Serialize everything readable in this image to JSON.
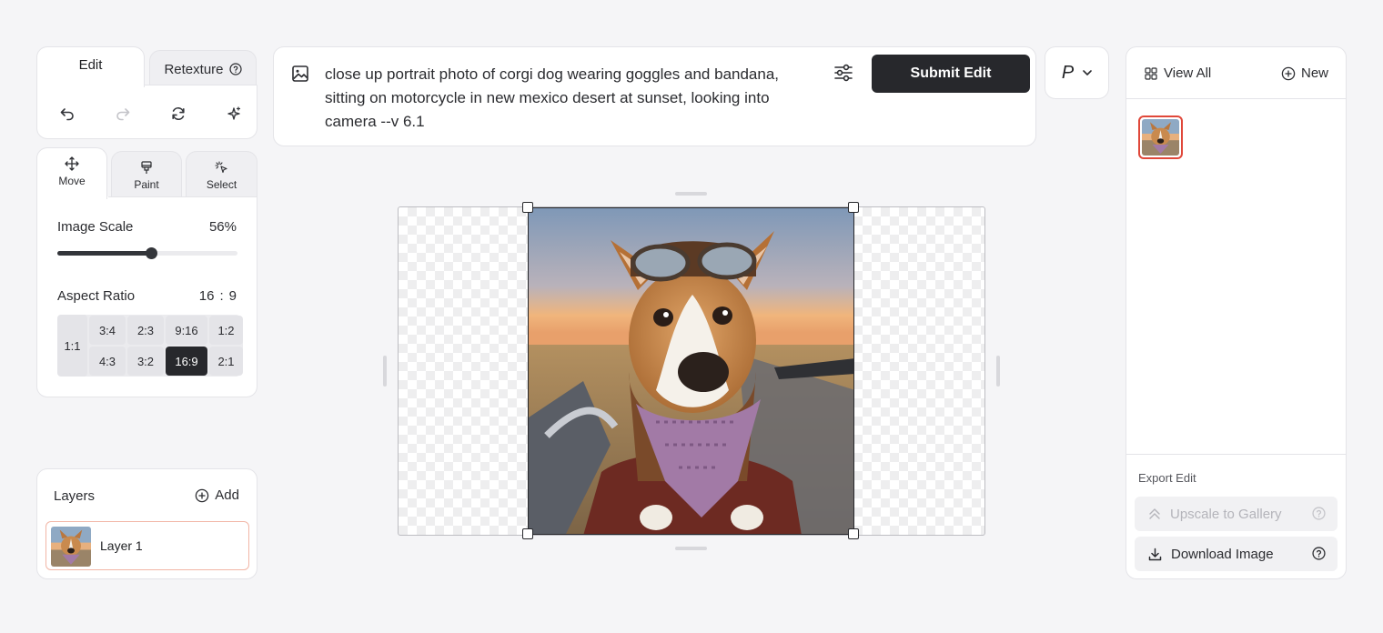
{
  "editor_tabs": {
    "edit_label": "Edit",
    "retexture_label": "Retexture"
  },
  "toolbar": {
    "undo_icon": "undo-icon",
    "redo_icon": "redo-icon",
    "reset_icon": "refresh-icon",
    "magic_icon": "sparkle-icon"
  },
  "modes": {
    "move_label": "Move",
    "paint_label": "Paint",
    "select_label": "Select",
    "active": "Move"
  },
  "image_scale": {
    "label": "Image Scale",
    "value_text": "56%",
    "value_fraction": 0.56
  },
  "aspect_ratio": {
    "label": "Aspect Ratio",
    "width": "16",
    "separator": ":",
    "height": "9",
    "square": "1:1",
    "top_row": [
      "3:4",
      "2:3",
      "9:16",
      "1:2"
    ],
    "bottom_row": [
      "4:3",
      "3:2",
      "16:9",
      "2:1"
    ],
    "selected": "16:9"
  },
  "layers": {
    "title": "Layers",
    "add_label": "Add",
    "items": [
      {
        "name": "Layer 1",
        "selected": true
      }
    ]
  },
  "prompt": {
    "text": "close up portrait photo of corgi dog wearing goggles and bandana, sitting on motorcycle in new mexico desert at sunset, looking into camera --v 6.1",
    "submit_label": "Submit Edit"
  },
  "model_selector": {
    "value": "P"
  },
  "gallery": {
    "view_all_label": "View All",
    "new_label": "New"
  },
  "export": {
    "title": "Export Edit",
    "upscale_label": "Upscale to Gallery",
    "download_label": "Download Image",
    "upscale_enabled": false
  },
  "colors": {
    "accent_dark": "#27282c",
    "selection_red": "#e0483a",
    "layer_border": "#f2b6a6",
    "background": "#f5f5f7"
  }
}
